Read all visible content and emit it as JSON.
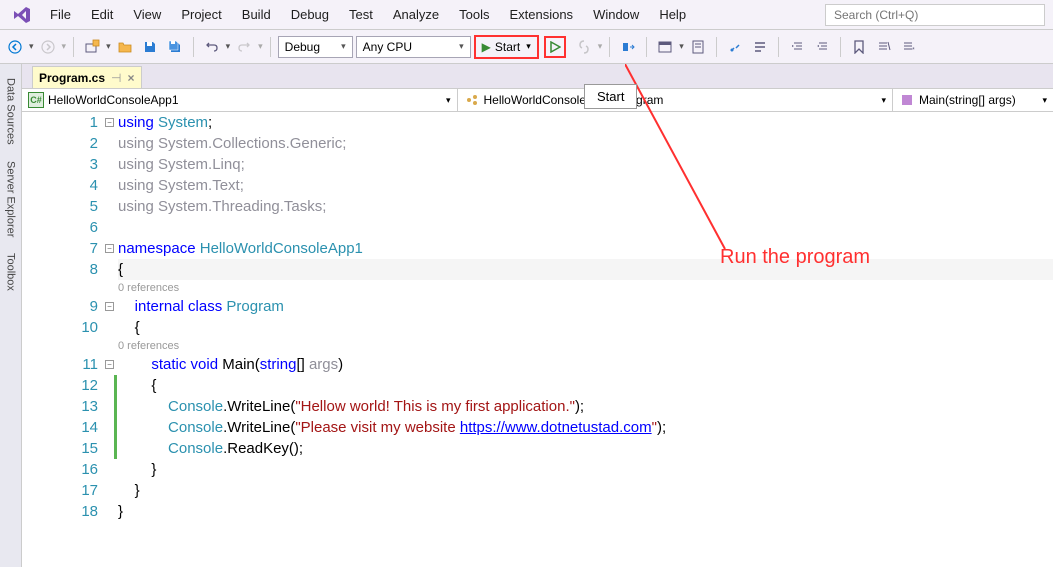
{
  "menu": {
    "items": [
      "File",
      "Edit",
      "View",
      "Project",
      "Build",
      "Debug",
      "Test",
      "Analyze",
      "Tools",
      "Extensions",
      "Window",
      "Help"
    ],
    "search_placeholder": "Search (Ctrl+Q)"
  },
  "toolbar": {
    "config": "Debug",
    "platform": "Any CPU",
    "start": "Start"
  },
  "tooltip": "Start",
  "sidetabs": [
    "Data Sources",
    "Server Explorer",
    "Toolbox"
  ],
  "filetab": "Program.cs",
  "nav": {
    "project": "HelloWorldConsoleApp1",
    "class": "HelloWorldConsoleApp1.Program",
    "method": "Main(string[] args)"
  },
  "code": {
    "l1_using": "using",
    "l1_sys": "System",
    "l2_ns": "System.Collections.Generic",
    "l3_ns": "System.Linq",
    "l4_ns": "System.Text",
    "l5_ns": "System.Threading.Tasks",
    "l7_kw": "namespace",
    "l7_name": "HelloWorldConsoleApp1",
    "ref0": "0 references",
    "l9_internal": "internal",
    "l9_class": "class",
    "l9_name": "Program",
    "l11_static": "static",
    "l11_void": "void",
    "l11_main": "Main",
    "l11_string": "string",
    "l11_args": "args",
    "l13_console": "Console",
    "l13_wl": ".WriteLine(",
    "l13_str": "\"Hellow world! This is my first application.\"",
    "l14_str": "\"Please visit my website ",
    "l14_url": "https://www.dotnetustad.com",
    "l14_end": "\"",
    "l15_rk": ".ReadKey();"
  },
  "annotation": "Run the program",
  "lines": [
    "1",
    "2",
    "3",
    "4",
    "5",
    "6",
    "7",
    "8",
    "9",
    "10",
    "11",
    "12",
    "13",
    "14",
    "15",
    "16",
    "17",
    "18"
  ]
}
